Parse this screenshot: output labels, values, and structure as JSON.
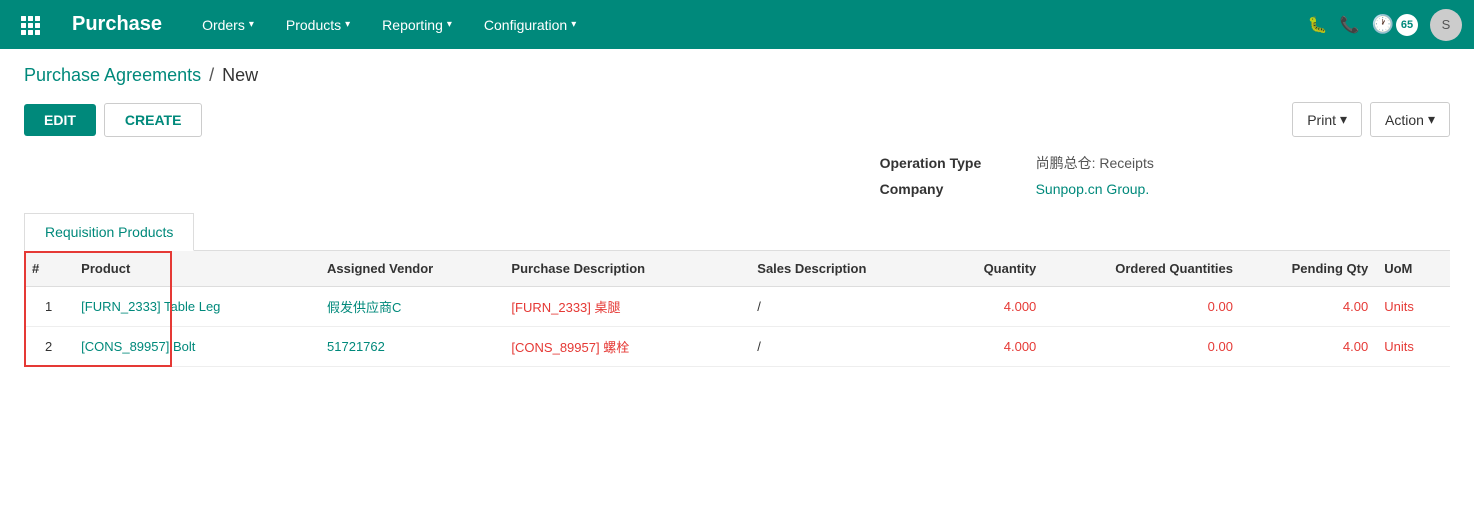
{
  "nav": {
    "brand": "Purchase",
    "items": [
      {
        "label": "Orders",
        "id": "orders"
      },
      {
        "label": "Products",
        "id": "products"
      },
      {
        "label": "Reporting",
        "id": "reporting"
      },
      {
        "label": "Configuration",
        "id": "configuration"
      }
    ],
    "icons": {
      "bug": "🐛",
      "phone": "📞",
      "badge_count": "65"
    }
  },
  "breadcrumb": {
    "parent": "Purchase Agreements",
    "separator": "/",
    "current": "New"
  },
  "toolbar": {
    "edit_label": "EDIT",
    "create_label": "CREATE",
    "print_label": "Print",
    "action_label": "Action"
  },
  "form": {
    "operation_type_label": "Operation Type",
    "operation_type_value": "尚鹏总仓: Receipts",
    "company_label": "Company",
    "company_value": "Sunpop.cn Group."
  },
  "tabs": [
    {
      "label": "Requisition Products",
      "active": true
    }
  ],
  "table": {
    "columns": [
      {
        "label": "#",
        "key": "num",
        "class": "col-hash"
      },
      {
        "label": "Product",
        "key": "product",
        "class": "col-product"
      },
      {
        "label": "Assigned Vendor",
        "key": "vendor",
        "class": "col-vendor"
      },
      {
        "label": "Purchase Description",
        "key": "purchase_desc",
        "class": "col-purchase-desc"
      },
      {
        "label": "Sales Description",
        "key": "sales_desc",
        "class": "col-sales-desc"
      },
      {
        "label": "Quantity",
        "key": "quantity",
        "class": "col-quantity num-col"
      },
      {
        "label": "Ordered Quantities",
        "key": "ordered",
        "class": "col-ordered num-col"
      },
      {
        "label": "Pending Qty",
        "key": "pending",
        "class": "col-pending num-col"
      },
      {
        "label": "UoM",
        "key": "uom",
        "class": "col-uom"
      }
    ],
    "rows": [
      {
        "num": "1",
        "product": "[FURN_2333] Table Leg",
        "vendor": "假发供应商C",
        "purchase_desc": "[FURN_2333] 桌腿",
        "sales_desc": "/",
        "quantity": "4.000",
        "ordered": "0.00",
        "pending": "4.00",
        "uom": "Units"
      },
      {
        "num": "2",
        "product": "[CONS_89957] Bolt",
        "vendor": "51721762",
        "purchase_desc": "[CONS_89957] 螺栓",
        "sales_desc": "/",
        "quantity": "4.000",
        "ordered": "0.00",
        "pending": "4.00",
        "uom": "Units"
      }
    ]
  }
}
